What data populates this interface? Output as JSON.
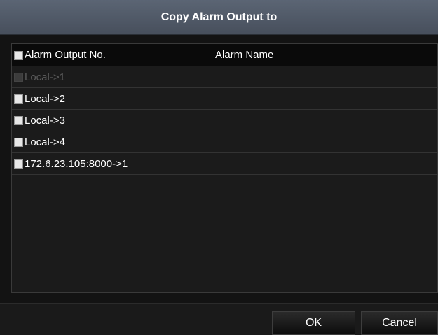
{
  "dialog": {
    "title": "Copy Alarm Output to"
  },
  "table": {
    "columns": [
      "Alarm Output No.",
      "Alarm Name"
    ],
    "rows": [
      {
        "label": "Local->1",
        "alarm_name": "",
        "disabled": true
      },
      {
        "label": "Local->2",
        "alarm_name": "",
        "disabled": false
      },
      {
        "label": "Local->3",
        "alarm_name": "",
        "disabled": false
      },
      {
        "label": "Local->4",
        "alarm_name": "",
        "disabled": false
      },
      {
        "label": "172.6.23.105:8000->1",
        "alarm_name": "",
        "disabled": false
      }
    ]
  },
  "buttons": {
    "ok": "OK",
    "cancel": "Cancel"
  },
  "colors": {
    "title_bar": "#4f5866",
    "background": "#131313",
    "text": "#ffffff",
    "disabled_text": "#5a5a5a"
  }
}
